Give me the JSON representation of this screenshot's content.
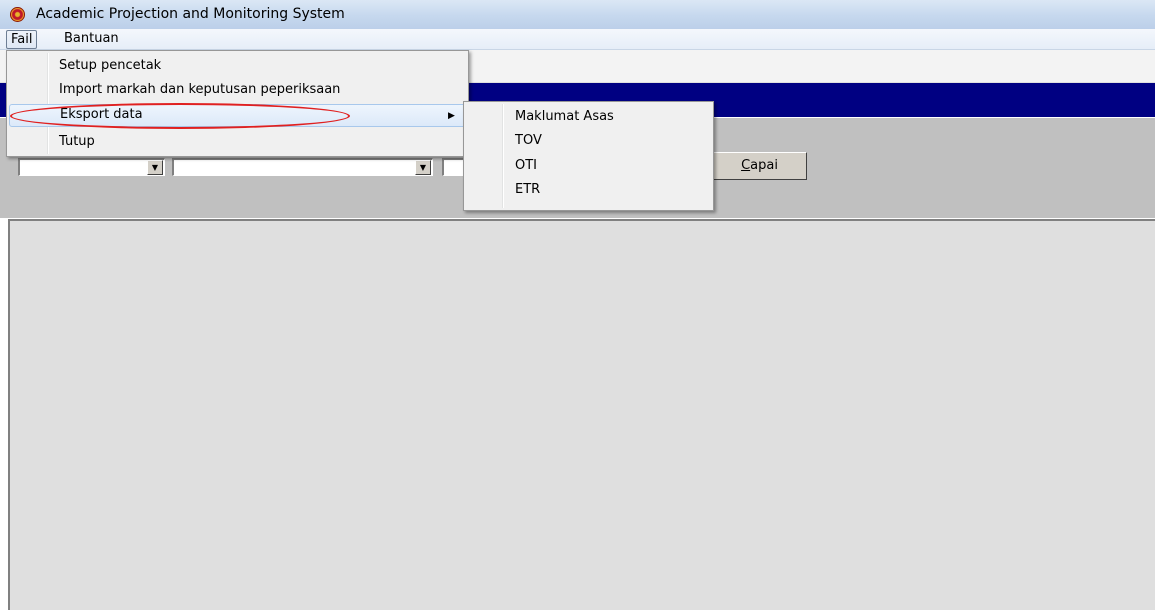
{
  "window": {
    "title": "Academic Projection and Monitoring  System",
    "icon": "app-target-icon"
  },
  "menubar": {
    "items": [
      {
        "label": "Fail",
        "active": true
      },
      {
        "label": "Bantuan",
        "active": false
      }
    ]
  },
  "file_menu": {
    "items": [
      {
        "label": "Setup pencetak"
      },
      {
        "label": "Import markah dan keputusan peperiksaan"
      },
      {
        "label": "Eksport data",
        "has_submenu": true,
        "highlighted": true
      },
      {
        "label": "Tutup"
      }
    ],
    "submenu_arrow": "▶"
  },
  "export_submenu": {
    "items": [
      {
        "label": "Maklumat Asas"
      },
      {
        "label": "TOV"
      },
      {
        "label": "OTI"
      },
      {
        "label": "ETR"
      }
    ]
  },
  "filters": {
    "combo1_value": "",
    "combo2_value": "",
    "combo3_value": "",
    "capai_button": {
      "accel": "C",
      "rest": "apai"
    }
  },
  "colors": {
    "banner": "#000082",
    "annotation_ellipse": "#e02020",
    "panel": "#c0c0c0"
  }
}
